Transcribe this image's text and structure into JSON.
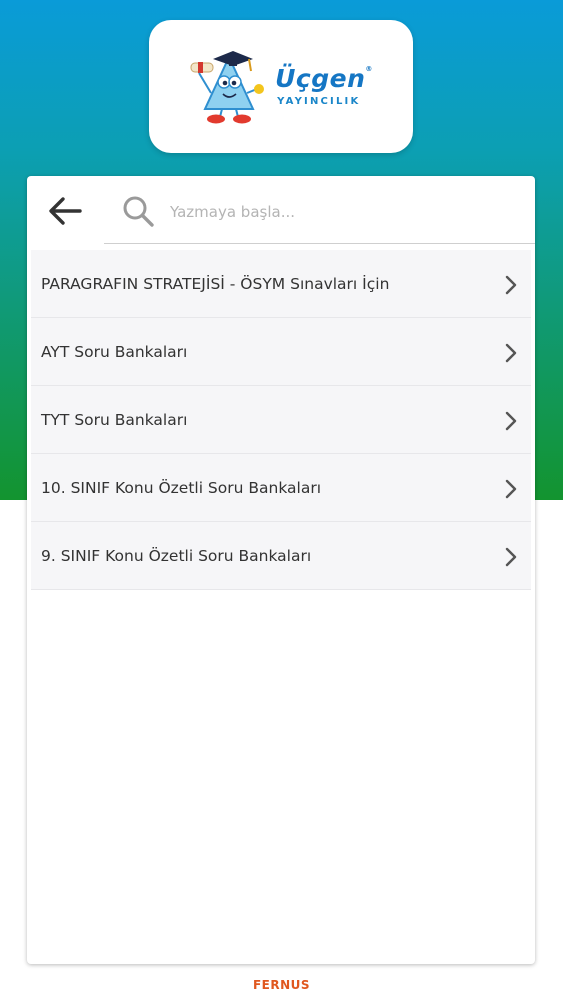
{
  "header": {
    "logo": {
      "brand_name": "Üçgen",
      "brand_mark": "®",
      "brand_sub": "YAYINCILIK",
      "brand_color": "#1576c4",
      "mascot_icon": "mascot-triangle-graduate-icon"
    }
  },
  "search": {
    "back_icon": "arrow-left-icon",
    "search_icon": "search-icon",
    "placeholder": "Yazmaya başla...",
    "value": ""
  },
  "list": {
    "items": [
      {
        "label": "PARAGRAFIN STRATEJİSİ - ÖSYM Sınavları İçin",
        "icon": "chevron-right-icon"
      },
      {
        "label": "AYT Soru Bankaları",
        "icon": "chevron-right-icon"
      },
      {
        "label": "TYT Soru Bankaları",
        "icon": "chevron-right-icon"
      },
      {
        "label": "10. SINIF Konu Özetli Soru Bankaları",
        "icon": "chevron-right-icon"
      },
      {
        "label": "9. SINIF Konu Özetli Soru Bankaları",
        "icon": "chevron-right-icon"
      }
    ]
  },
  "footer": {
    "brand": "FERNUS",
    "brand_color": "#e0581f"
  },
  "colors": {
    "gradient_top": "#0a9bd8",
    "gradient_bottom": "#13942f",
    "list_item_bg": "#f6f6f8",
    "text": "#333333"
  }
}
